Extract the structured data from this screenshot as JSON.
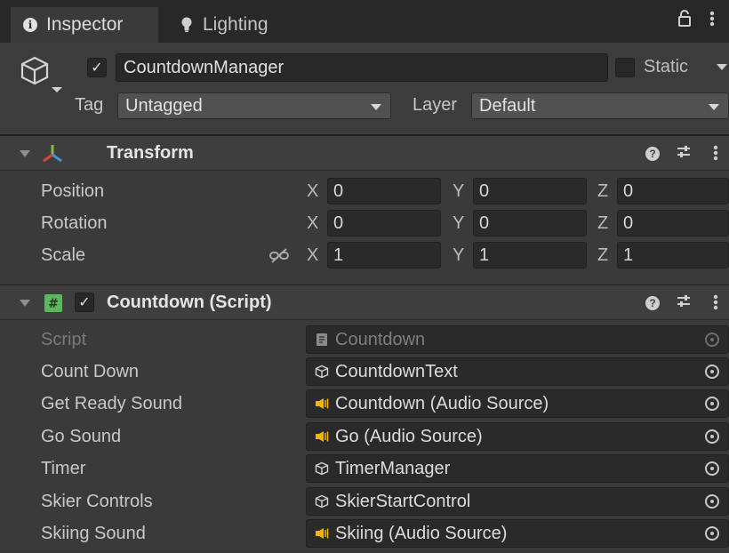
{
  "tabs": [
    {
      "label": "Inspector",
      "icon": "info-icon",
      "active": true
    },
    {
      "label": "Lighting",
      "icon": "lightbulb-icon",
      "active": false
    }
  ],
  "gameobject": {
    "name": "CountdownManager",
    "active": true,
    "static_label": "Static",
    "tag_label": "Tag",
    "tag_value": "Untagged",
    "layer_label": "Layer",
    "layer_value": "Default"
  },
  "transform": {
    "title": "Transform",
    "rows": [
      {
        "label": "Position",
        "x": "0",
        "y": "0",
        "z": "0"
      },
      {
        "label": "Rotation",
        "x": "0",
        "y": "0",
        "z": "0"
      },
      {
        "label": "Scale",
        "x": "1",
        "y": "1",
        "z": "1"
      }
    ],
    "axes": {
      "x": "X",
      "y": "Y",
      "z": "Z"
    }
  },
  "script_component": {
    "title": "Countdown (Script)",
    "enabled": true,
    "fields": [
      {
        "label": "Script",
        "value": "Countdown",
        "icon": "script-file-icon",
        "disabled": true
      },
      {
        "label": "Count Down",
        "value": "CountdownText",
        "icon": "gameobject-icon"
      },
      {
        "label": "Get Ready Sound",
        "value": "Countdown (Audio Source)",
        "icon": "audio-source-icon"
      },
      {
        "label": "Go Sound",
        "value": "Go (Audio Source)",
        "icon": "audio-source-icon"
      },
      {
        "label": "Timer",
        "value": "TimerManager",
        "icon": "gameobject-icon"
      },
      {
        "label": "Skier Controls",
        "value": "SkierStartControl",
        "icon": "gameobject-icon"
      },
      {
        "label": "Skiing Sound",
        "value": "Skiing (Audio Source)",
        "icon": "audio-source-icon"
      }
    ]
  },
  "colors": {
    "panel_bg": "#3a3a3a",
    "tab_bar_bg": "#282828",
    "field_bg": "#2a2a2a",
    "audio_icon": "#f4b400",
    "transform_icon_red": "#e0453a",
    "transform_icon_green": "#7cc242",
    "transform_icon_blue": "#4a8fe0",
    "script_icon": "#5cb85c"
  }
}
